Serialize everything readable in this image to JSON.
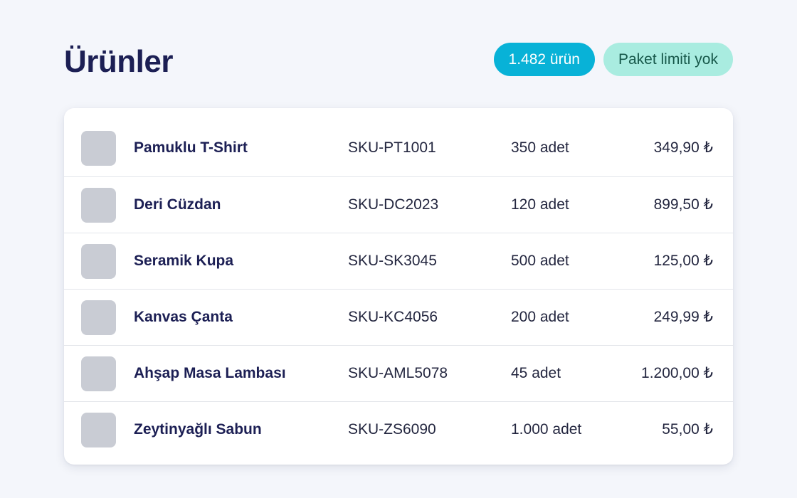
{
  "page": {
    "title": "Ürünler"
  },
  "badges": {
    "count": "1.482 ürün",
    "limit": "Paket limiti yok"
  },
  "colors": {
    "title": "#1c1f54",
    "badge_count_bg": "#08b2d7",
    "badge_limit_bg": "#a9ece0",
    "badge_limit_text": "#17584a",
    "thumbnail_placeholder": "#c9ccd4"
  },
  "products": [
    {
      "name": "Pamuklu T-Shirt",
      "sku": "SKU-PT1001",
      "stock": "350 adet",
      "price": "349,90 ₺"
    },
    {
      "name": "Deri Cüzdan",
      "sku": "SKU-DC2023",
      "stock": "120 adet",
      "price": "899,50 ₺"
    },
    {
      "name": "Seramik Kupa",
      "sku": "SKU-SK3045",
      "stock": "500 adet",
      "price": "125,00 ₺"
    },
    {
      "name": "Kanvas Çanta",
      "sku": "SKU-KC4056",
      "stock": "200 adet",
      "price": "249,99 ₺"
    },
    {
      "name": "Ahşap Masa Lambası",
      "sku": "SKU-AML5078",
      "stock": "45 adet",
      "price": "1.200,00 ₺"
    },
    {
      "name": "Zeytinyağlı Sabun",
      "sku": "SKU-ZS6090",
      "stock": "1.000 adet",
      "price": "55,00 ₺"
    }
  ]
}
